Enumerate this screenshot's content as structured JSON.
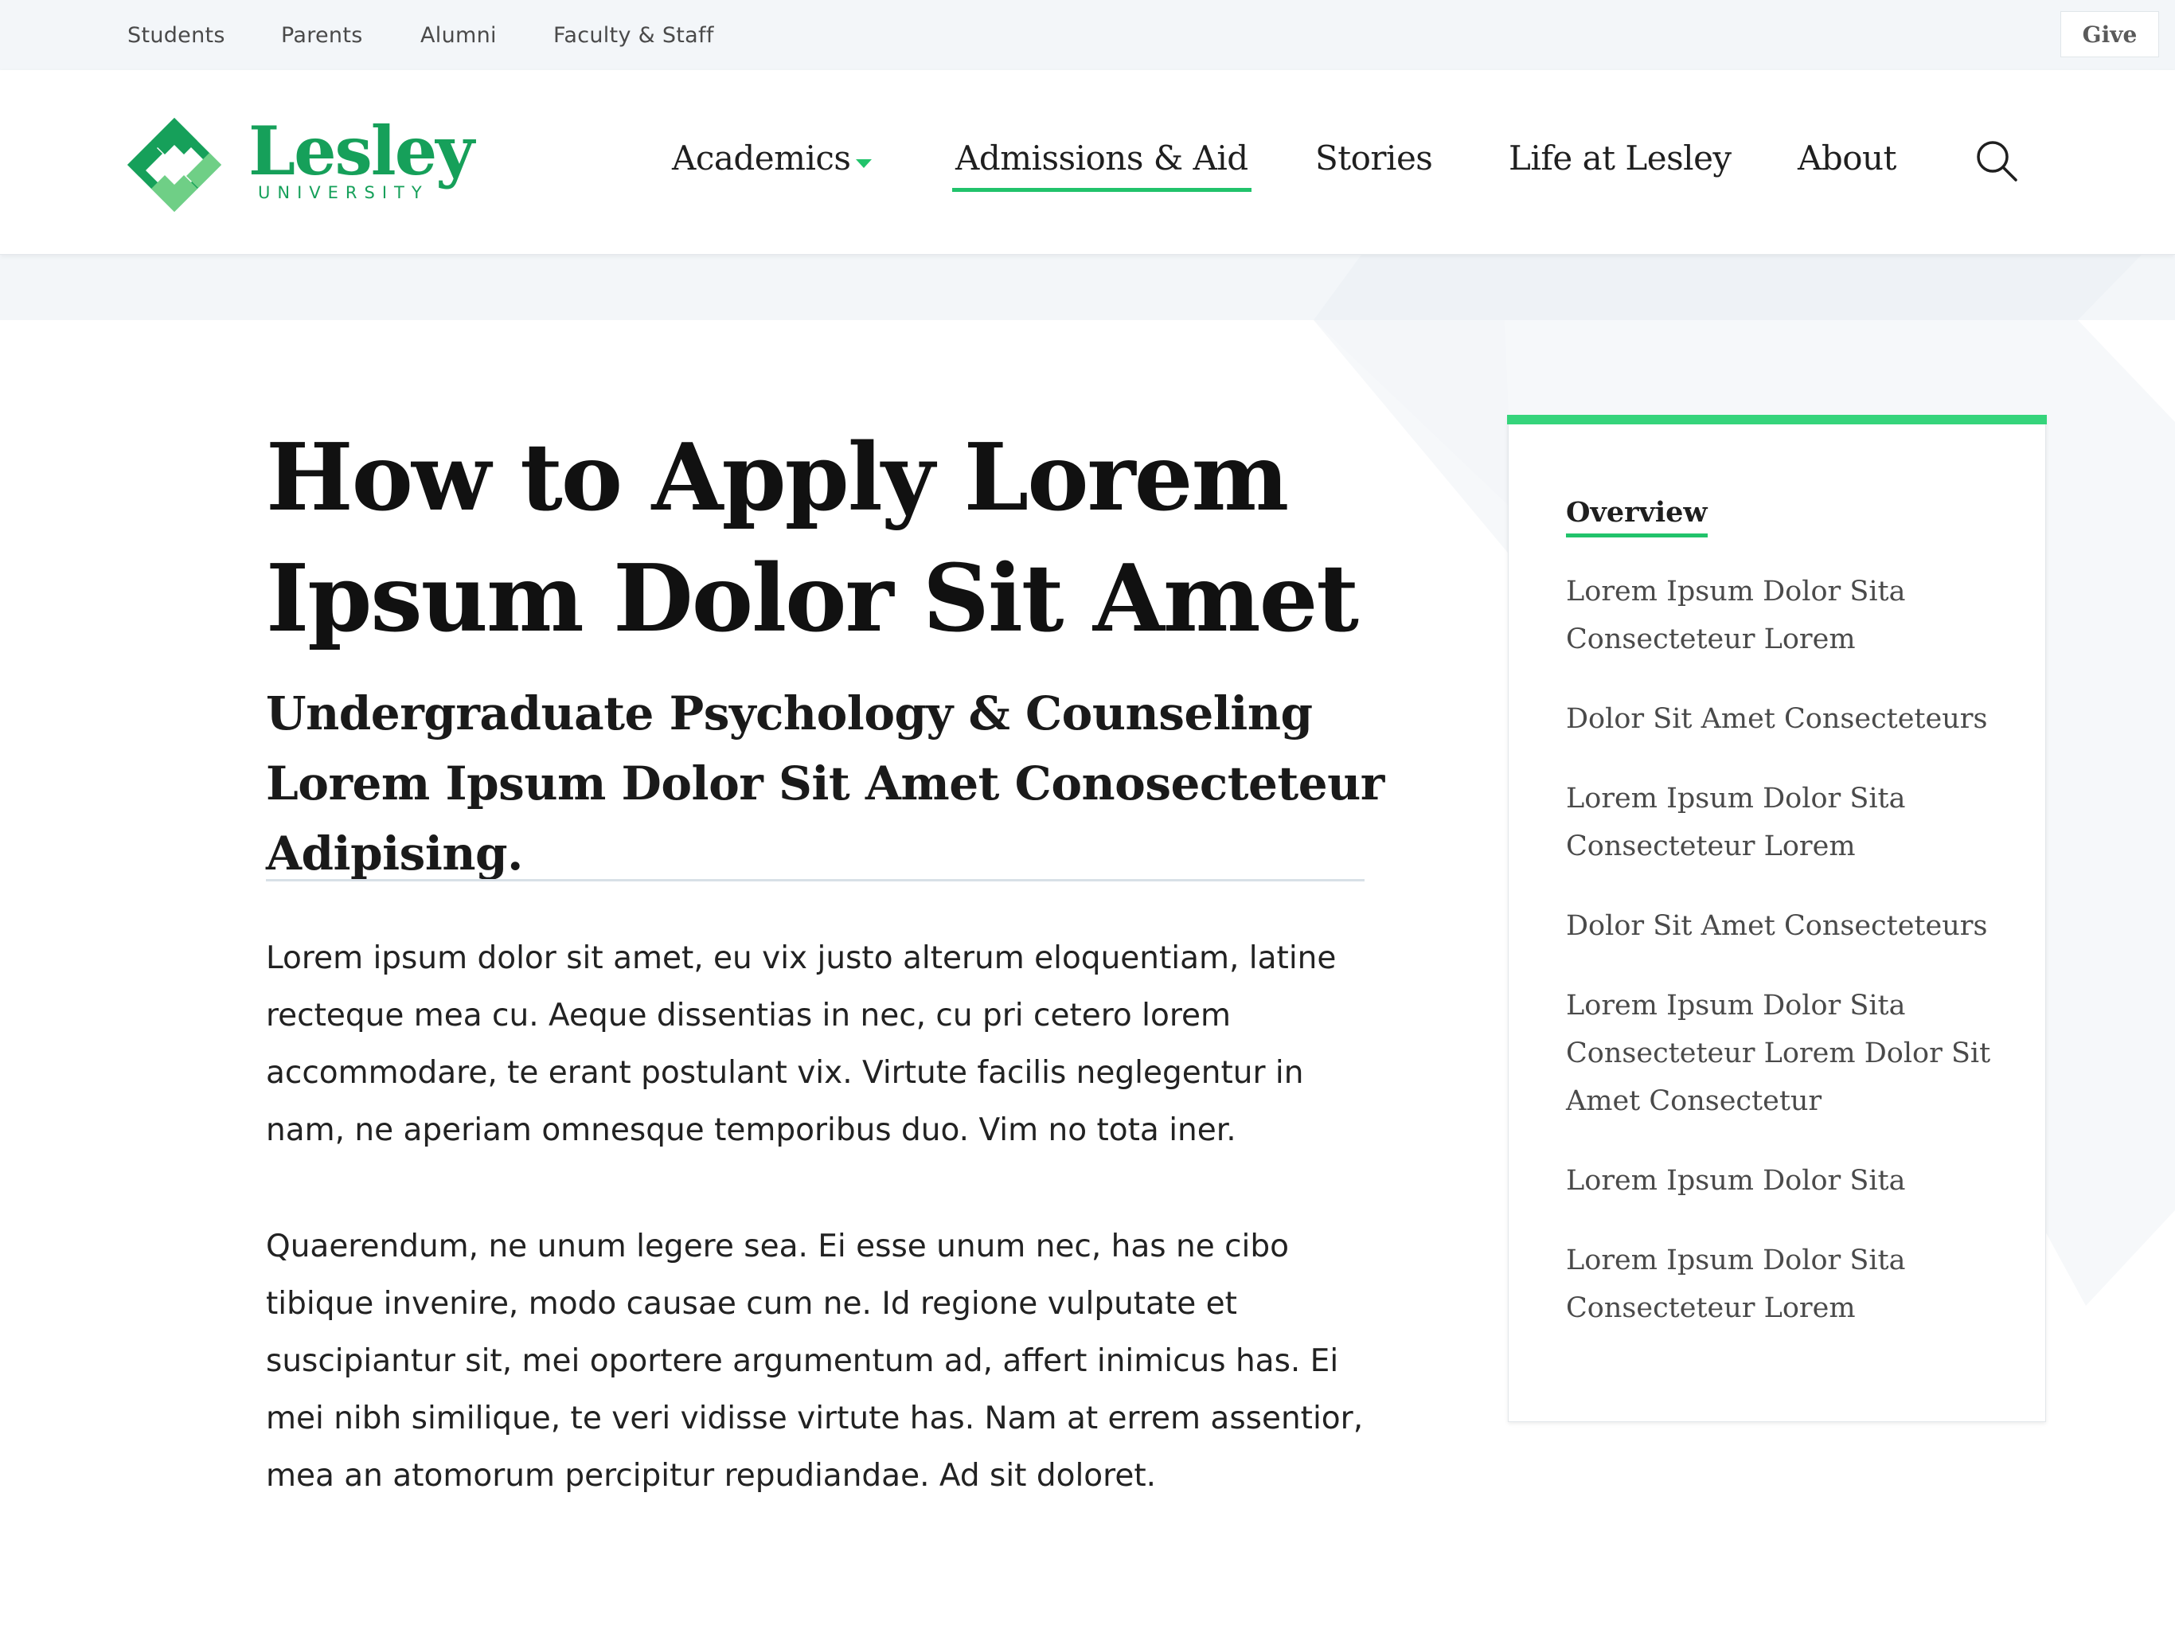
{
  "utility": {
    "links": [
      "Students",
      "Parents",
      "Alumni",
      "Faculty & Staff"
    ],
    "give": "Give"
  },
  "logo": {
    "word": "Lesley",
    "sub": "UNIVERSITY"
  },
  "nav": {
    "items": [
      "Academics",
      "Admissions & Aid",
      "Stories",
      "Life at Lesley",
      "About"
    ],
    "active": "Admissions & Aid"
  },
  "page": {
    "title": "How to Apply Lorem Ipsum Dolor Sit Amet",
    "subtitle": "Undergraduate Psychology & Counseling Lorem Ipsum Dolor Sit Amet Conosecteteur Adipising.",
    "paragraphs": [
      "Lorem ipsum dolor sit amet, eu vix justo alterum eloquentiam, latine recteque mea cu. Aeque dissentias in nec, cu pri cetero lorem accommodare, te erant postulant vix. Virtute facilis neglegentur in nam, ne aperiam omnesque temporibus duo. Vim no tota iner.",
      "Quaerendum, ne unum legere sea. Ei esse unum nec, has ne cibo tibique invenire, modo causae cum ne. Id regione vulputate et suscipiantur sit, mei oportere argumentum ad, affert inimicus has. Ei mei nibh similique, te veri vidisse virtute has. Nam at errem assentior, mea an atomorum percipitur repudiandae. Ad sit doloret."
    ]
  },
  "sidebar": {
    "overview": "Overview",
    "links": [
      "Lorem Ipsum Dolor Sita Consecteteur Lorem",
      "Dolor Sit Amet Consecteteurs",
      "Lorem Ipsum Dolor Sita Consecteteur Lorem",
      "Dolor Sit Amet Consecteteurs",
      "Lorem Ipsum Dolor Sita Consecteteur Lorem Dolor Sit Amet Consectetur",
      "Lorem Ipsum Dolor Sita",
      "Lorem Ipsum Dolor Sita Consecteteur Lorem"
    ]
  },
  "colors": {
    "brand_green": "#16a05a",
    "accent_green": "#21c36b",
    "utility_bg": "#f3f6f9"
  },
  "icons": [
    "lesley-logo-icon",
    "caret-down-icon",
    "search-icon"
  ]
}
